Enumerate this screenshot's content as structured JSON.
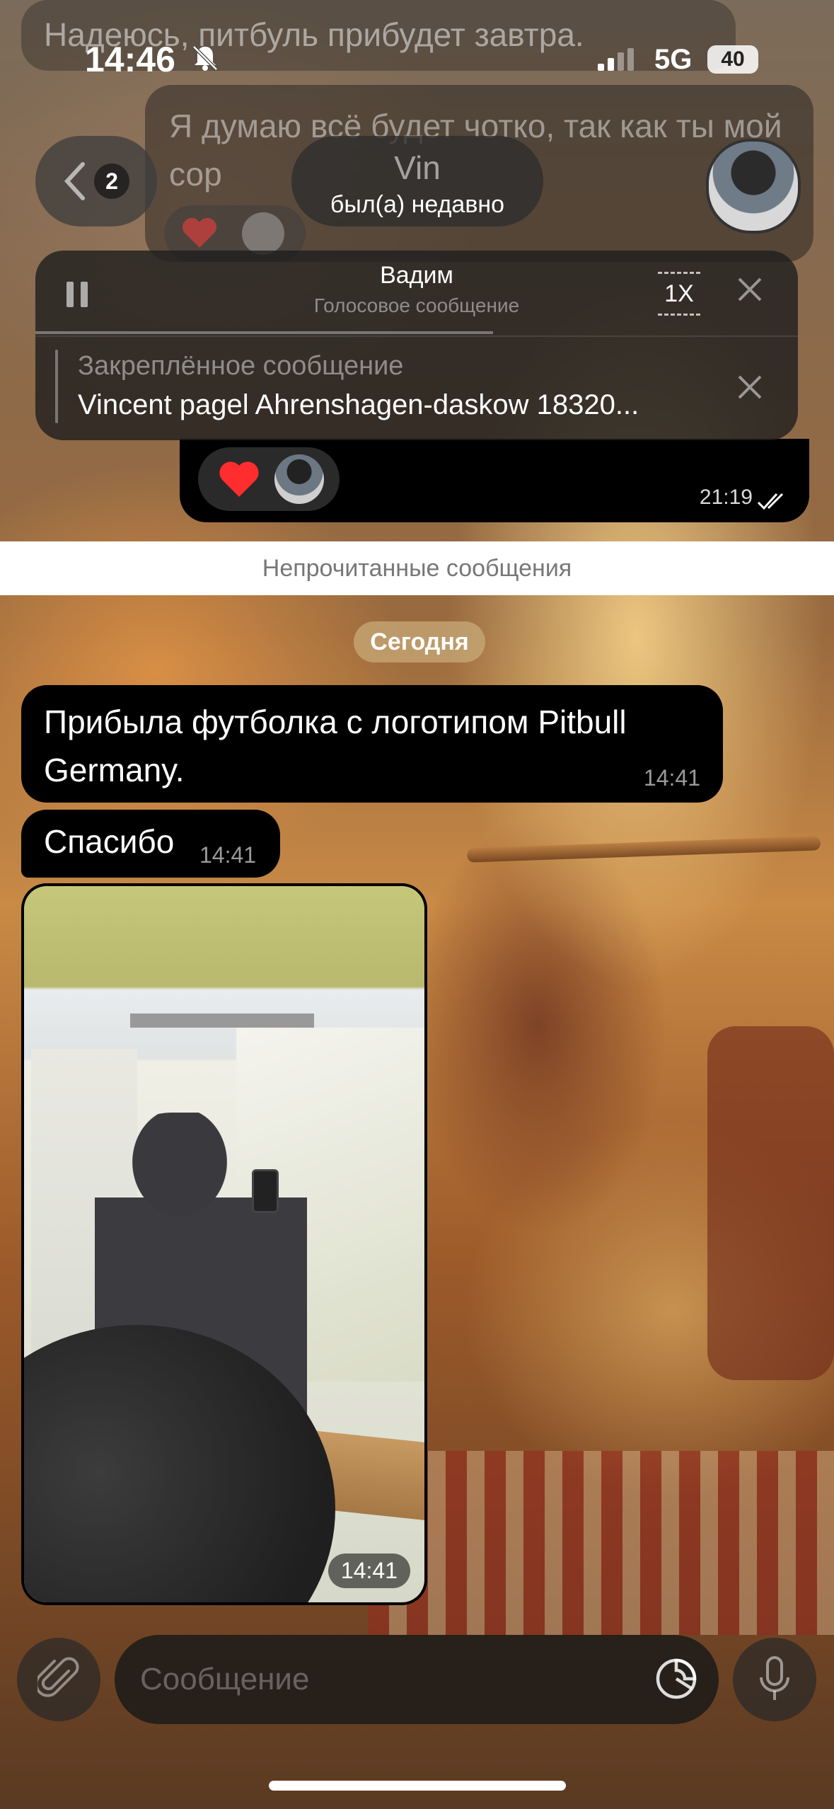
{
  "status_bar": {
    "time": "14:46",
    "network": "5G",
    "battery": "40"
  },
  "faded_messages": {
    "first": "Надеюсь, питбуль прибудет завтра.",
    "second": "Я думаю всё будет чотко, так как ты мой сор"
  },
  "header": {
    "back_count": "2",
    "contact_name": "Vin",
    "contact_status": "был(а) недавно"
  },
  "audio_player": {
    "title": "Вадим",
    "subtitle": "Голосовое сообщение",
    "speed": "1X",
    "progress": 0.6
  },
  "pinned": {
    "label": "Закреплённое сообщение",
    "text": "Vincent pagel Ahrenshagen-daskow 18320..."
  },
  "previous_message": {
    "reaction": "❤️",
    "time": "21:19"
  },
  "unread_divider": "Непрочитанные сообщения",
  "date_label": "Сегодня",
  "messages": [
    {
      "text": "Прибыла футболка с логотипом Pitbull Germany.",
      "time": "14:41"
    },
    {
      "text": "Спасибо",
      "time": "14:41"
    }
  ],
  "photo_message": {
    "time": "14:41"
  },
  "composer": {
    "placeholder": "Сообщение"
  },
  "colors": {
    "bubble": "#000000",
    "unread_bar": "#ffffff",
    "accent_heart": "#ff2d2d"
  }
}
